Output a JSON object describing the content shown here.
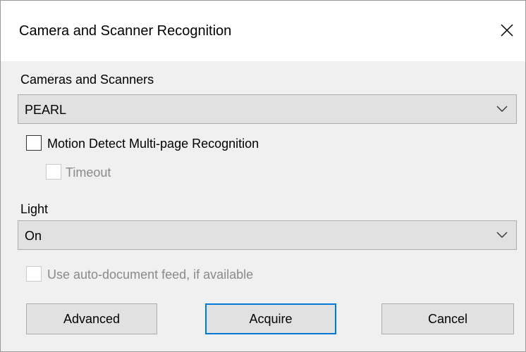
{
  "window": {
    "title": "Camera and Scanner Recognition",
    "close_icon": "close-icon"
  },
  "device": {
    "label": "Cameras and Scanners",
    "selected": "PEARL"
  },
  "motion_detect": {
    "label": "Motion Detect Multi-page Recognition",
    "checked": false
  },
  "timeout": {
    "label": "Timeout",
    "checked": false,
    "enabled": false
  },
  "light": {
    "label": "Light",
    "selected": "On"
  },
  "auto_feed": {
    "label": "Use auto-document feed, if available",
    "checked": false,
    "enabled": false
  },
  "buttons": {
    "advanced": "Advanced",
    "acquire": "Acquire",
    "cancel": "Cancel"
  },
  "colors": {
    "dialog_bg": "#f0f0f0",
    "control_bg": "#e1e1e1",
    "accent": "#0078d7",
    "disabled_text": "#8a8a8a"
  }
}
